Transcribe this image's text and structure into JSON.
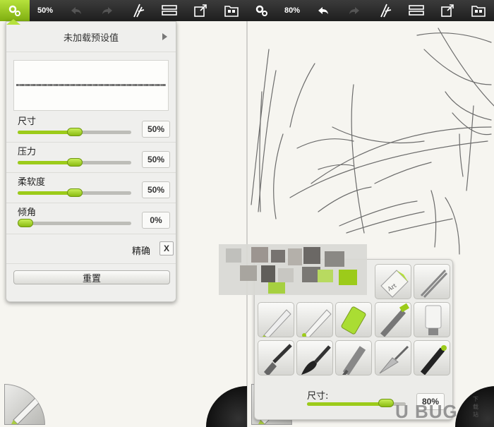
{
  "toolbar_left": {
    "zoom": "50%",
    "icons": [
      "gear-icon",
      "undo-icon",
      "redo-icon",
      "brush-select-icon",
      "layers-icon",
      "export-icon",
      "gallery-icon"
    ]
  },
  "toolbar_right": {
    "zoom": "80%",
    "icons": [
      "gear-icon",
      "undo-icon",
      "redo-icon",
      "brush-select-icon",
      "layers-icon",
      "export-icon",
      "gallery-icon"
    ]
  },
  "brush_panel": {
    "preset_label": "未加载预设值",
    "size_label": "尺寸",
    "size_value": "50%",
    "size_level": 0.5,
    "pressure_label": "压力",
    "pressure_value": "50%",
    "pressure_level": 0.5,
    "softness_label": "柔软度",
    "softness_value": "50%",
    "softness_level": 0.5,
    "tilt_label": "倾角",
    "tilt_value": "0%",
    "tilt_level": 0.0,
    "precise_label": "精确",
    "precise_toggle": "X",
    "reset_label": "重置"
  },
  "tool_palette": {
    "tools": [
      "eraser-tool",
      "sticker-tool",
      "tracing-tool",
      "pencil-tool",
      "pen-tool",
      "felt-tip-tool",
      "airbrush-tool",
      "paint-tube-tool",
      "flat-brush-tool",
      "watercolor-brush-tool",
      "gloop-pen-tool",
      "palette-knife-tool",
      "ink-pen-tool"
    ],
    "size_label": "尺寸:",
    "size_value": "80%",
    "size_level": 0.8
  },
  "colors": {
    "accent_green": "#9ccb1a",
    "toolbar_dark": "#2a2a2a",
    "canvas": "#f6f5f0"
  },
  "watermark": "U BUG",
  "watermark_small": "下载站"
}
